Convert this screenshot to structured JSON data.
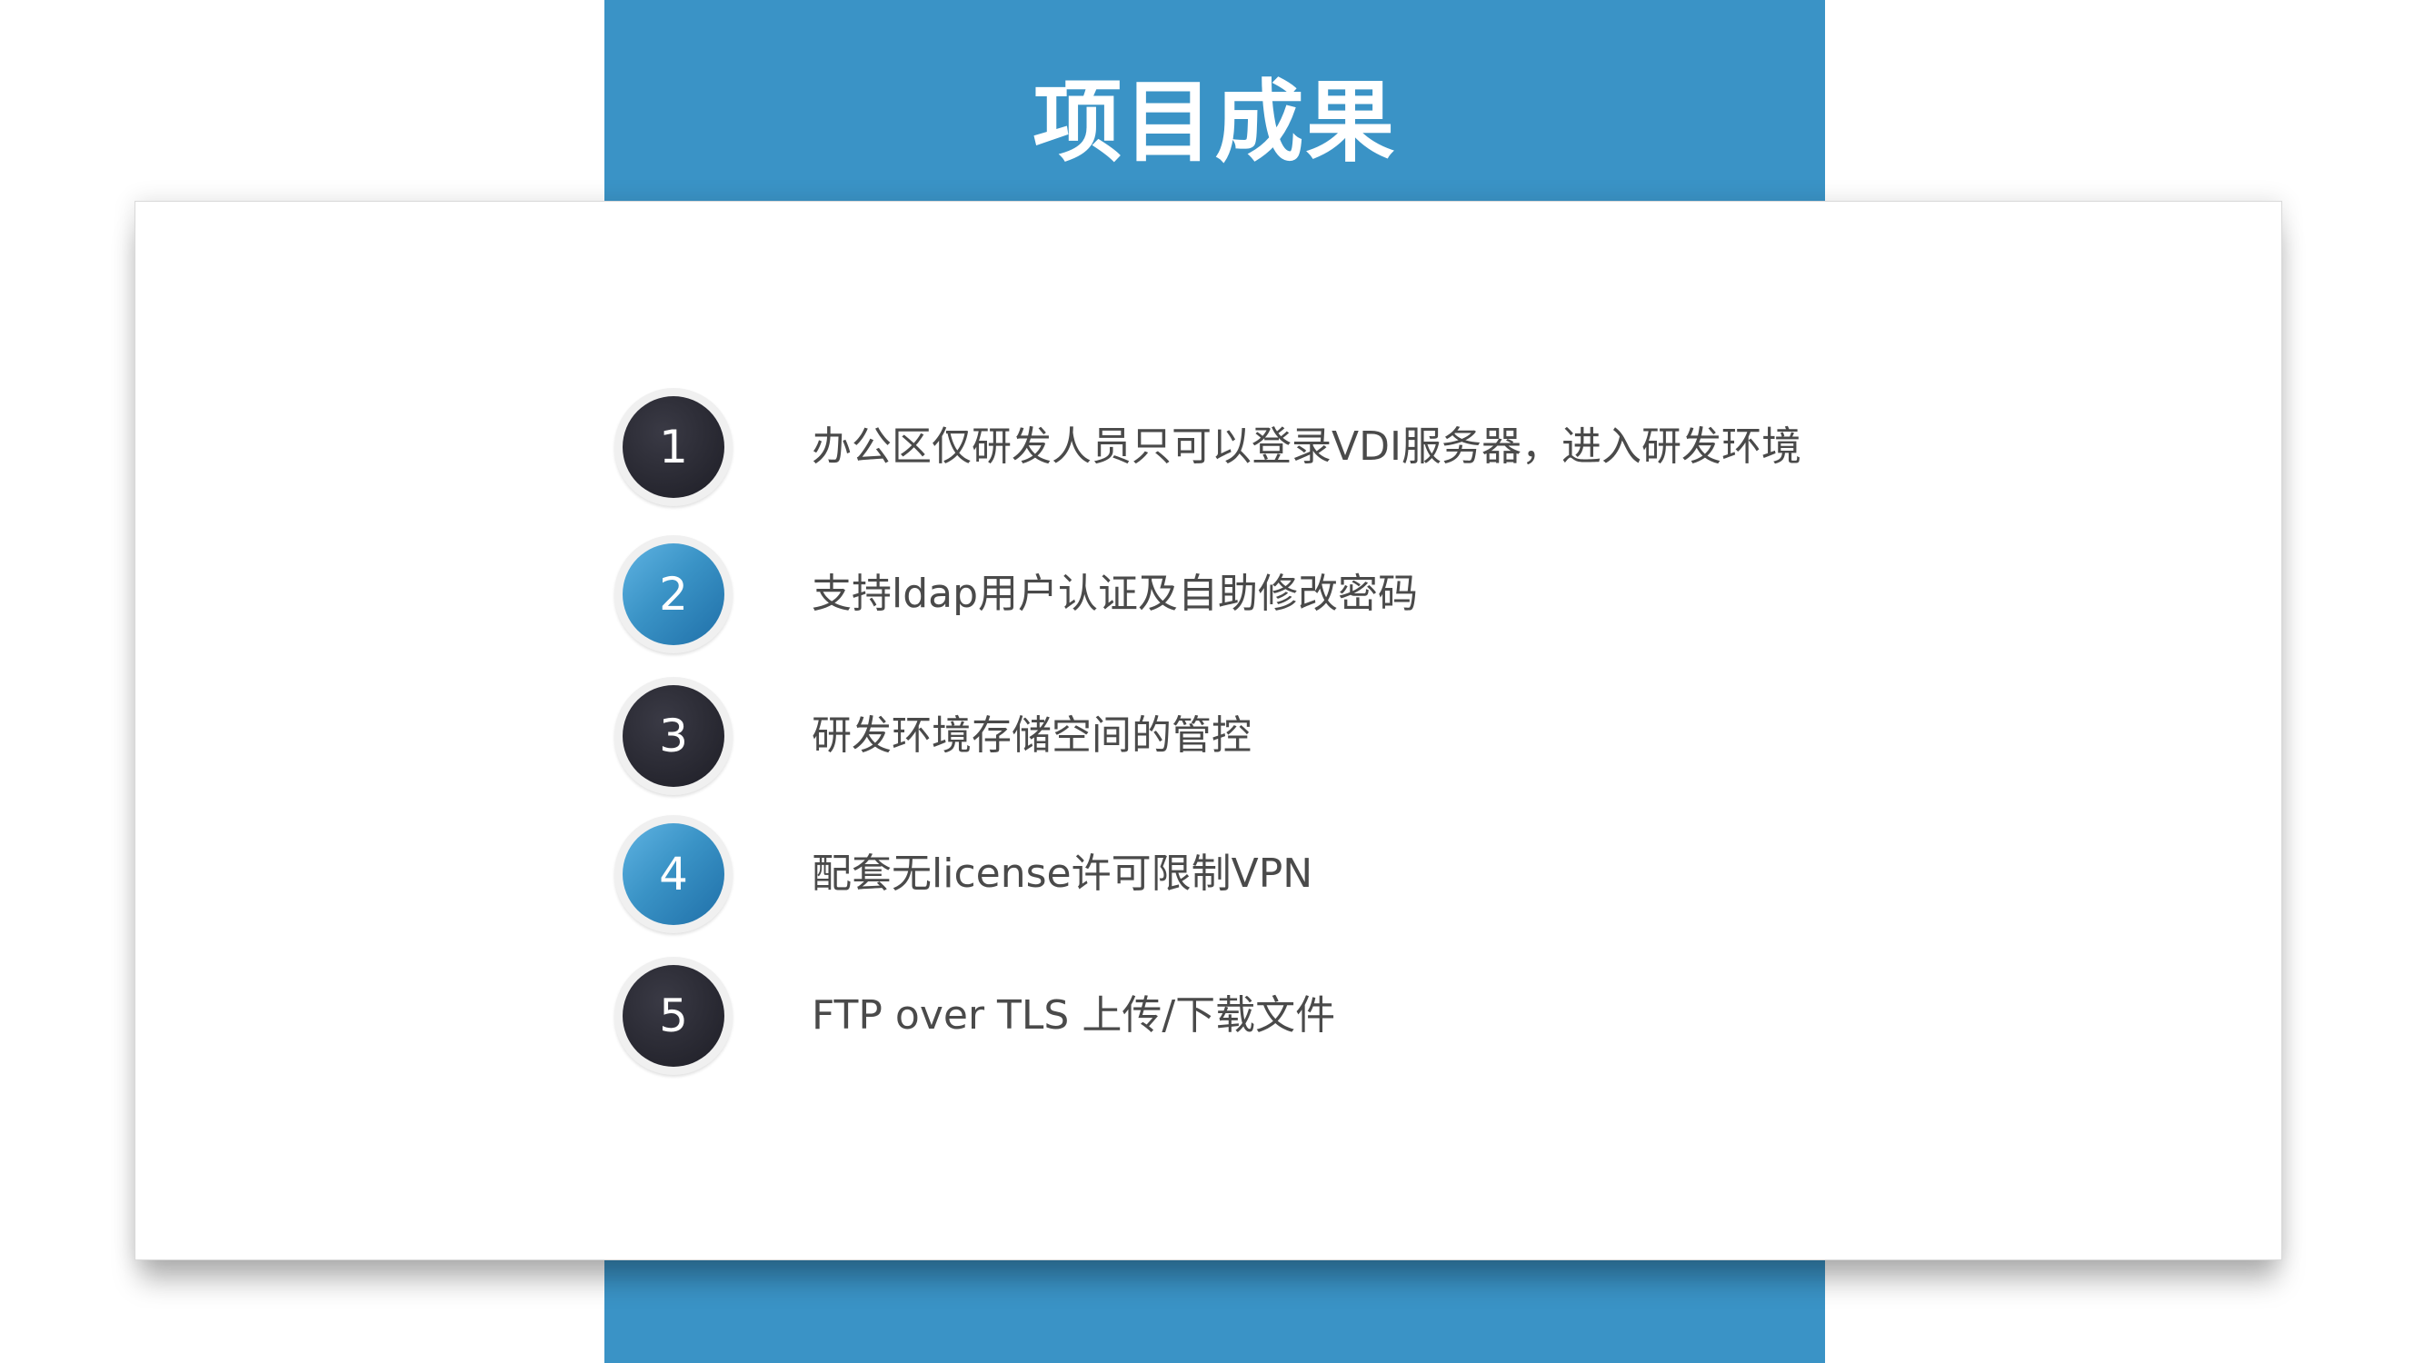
{
  "slide": {
    "title": "项目成果",
    "accent_color": "#3a93c6",
    "dark_color": "#26262f"
  },
  "items": [
    {
      "number": "1",
      "style": "dark",
      "text": "办公区仅研发人员只可以登录VDI服务器，进入研发环境"
    },
    {
      "number": "2",
      "style": "blue",
      "text": "支持ldap用户认证及自助修改密码"
    },
    {
      "number": "3",
      "style": "dark",
      "text": "研发环境存储空间的管控"
    },
    {
      "number": "4",
      "style": "blue",
      "text": "配套无license许可限制VPN"
    },
    {
      "number": "5",
      "style": "dark",
      "text": "FTP over TLS 上传/下载文件"
    }
  ]
}
